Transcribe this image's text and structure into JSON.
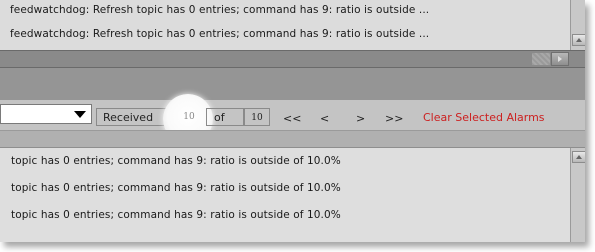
{
  "log": {
    "lines": [
      "feedwatchdog: Refresh topic has 0 entries; command has 9: ratio is outside ...",
      "feedwatchdog: Refresh topic has 0 entries; command has 9: ratio is outside ..."
    ]
  },
  "pager": {
    "received_label": "Received",
    "received_value": "10",
    "of_label": "of",
    "total_value": "10",
    "first_label": "<<",
    "prev_label": "<",
    "next_label": ">",
    "last_label": ">>",
    "clear_label": "Clear Selected Alarms"
  },
  "alarms": {
    "lines": [
      "topic has 0 entries; command has 9: ratio is outside of 10.0%",
      "topic has 0 entries; command has 9: ratio is outside of 10.0%",
      "topic has 0 entries; command has 9: ratio is outside of 10.0%"
    ]
  },
  "colors": {
    "clear_text": "#cc2020"
  }
}
